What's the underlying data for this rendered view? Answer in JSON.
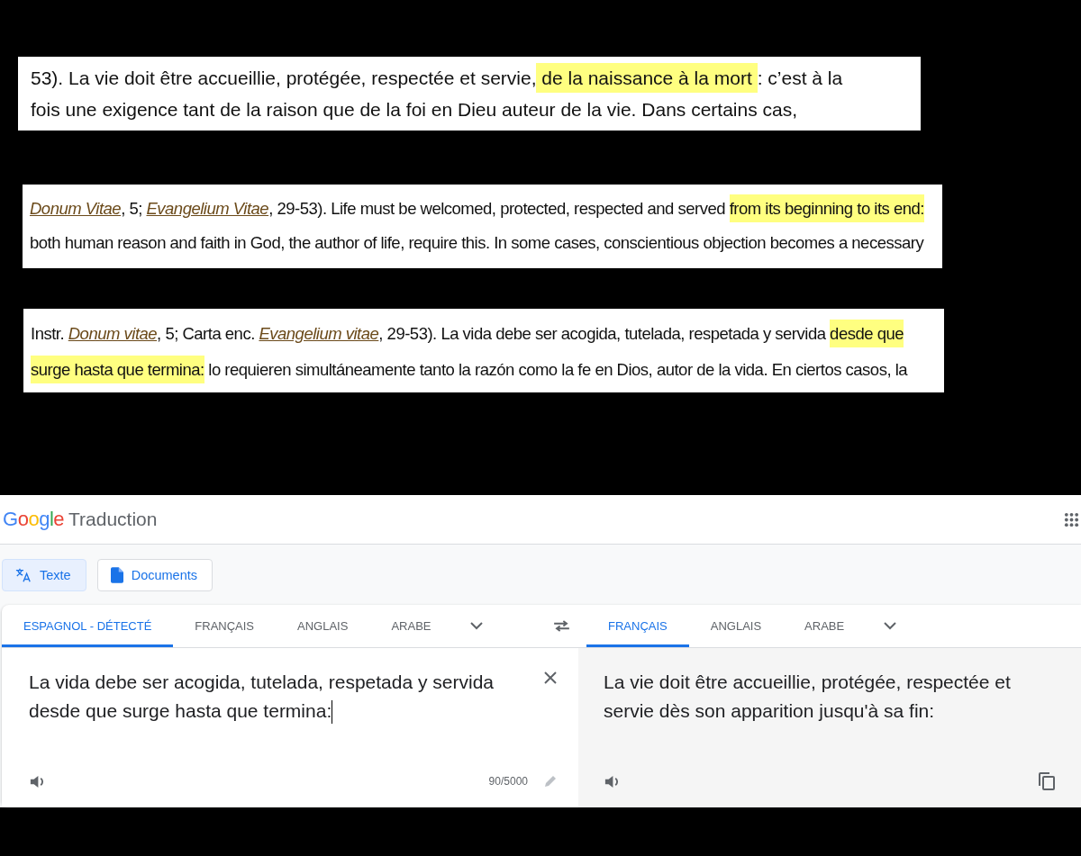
{
  "excerpts": [
    {
      "lines": [
        [
          {
            "kind": "plain",
            "text": "53). La vie doit être accueillie, protégée, respectée et servie,"
          },
          {
            "kind": "highlight",
            "text": " de la naissance à la mort "
          },
          {
            "kind": "plain",
            "text": ": c’est à la"
          }
        ],
        [
          {
            "kind": "plain",
            "text": "fois une exigence tant de la raison que de la foi en Dieu auteur de la vie. Dans certains cas,"
          }
        ]
      ]
    },
    {
      "lines": [
        [
          {
            "kind": "link",
            "text": "Donum Vitae"
          },
          {
            "kind": "plain",
            "text": ", 5; "
          },
          {
            "kind": "link",
            "text": "Evangelium Vitae"
          },
          {
            "kind": "plain",
            "text": ", 29-53). Life must be welcomed, protected, respected and served "
          },
          {
            "kind": "highlight",
            "text": "from its beginning to its end:"
          }
        ],
        [
          {
            "kind": "plain",
            "text": "both human reason and faith in God, the author of life, require this. In some cases, conscientious objection becomes a necessary"
          }
        ]
      ]
    },
    {
      "lines": [
        [
          {
            "kind": "plain",
            "text": "Instr. "
          },
          {
            "kind": "link",
            "text": "Donum vitae"
          },
          {
            "kind": "plain",
            "text": ", 5; Carta enc. "
          },
          {
            "kind": "link",
            "text": "Evangelium vitae"
          },
          {
            "kind": "plain",
            "text": ", 29-53). La vida debe ser acogida, tutelada, respetada y servida "
          },
          {
            "kind": "highlight",
            "text": "desde que"
          }
        ],
        [
          {
            "kind": "highlight",
            "text": "surge hasta que termina:"
          },
          {
            "kind": "plain",
            "text": " lo requieren simultáneamente tanto la razón como la fe en Dios, autor de la vida. En ciertos casos, la"
          }
        ]
      ]
    }
  ],
  "translator": {
    "logo": "Google",
    "title": "Traduction",
    "modes": [
      {
        "label": "Texte",
        "selected": true,
        "kind": "text"
      },
      {
        "label": "Documents",
        "selected": false,
        "kind": "document"
      }
    ],
    "source_languages": [
      {
        "label": "ESPAGNOL - DÉTECTÉ",
        "selected": true
      },
      {
        "label": "FRANÇAIS",
        "selected": false
      },
      {
        "label": "ANGLAIS",
        "selected": false
      },
      {
        "label": "ARABE",
        "selected": false
      }
    ],
    "target_languages": [
      {
        "label": "FRANÇAIS",
        "selected": true
      },
      {
        "label": "ANGLAIS",
        "selected": false
      },
      {
        "label": "ARABE",
        "selected": false
      }
    ],
    "source_text": "La vida debe ser acogida, tutelada, respetada y servida desde que surge hasta que termina:",
    "char_count": "90/5000",
    "translation": "La vie doit être accueillie, protégée, respectée et servie dès son apparition jusqu'à sa fin:"
  }
}
